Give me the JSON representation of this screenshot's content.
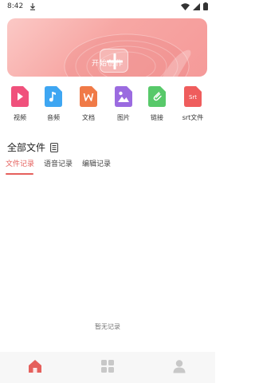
{
  "status_bar": {
    "time": "8:42"
  },
  "banner": {
    "label": "开始创作"
  },
  "tools": [
    {
      "label": "视频",
      "icon": "video-icon",
      "color": "#f0517c"
    },
    {
      "label": "音频",
      "icon": "audio-icon",
      "color": "#3ea6f2"
    },
    {
      "label": "文档",
      "icon": "word-doc-icon",
      "color": "#f07a47"
    },
    {
      "label": "图片",
      "icon": "image-icon",
      "color": "#9b6be0"
    },
    {
      "label": "链接",
      "icon": "link-icon",
      "color": "#58c96a"
    },
    {
      "label": "srt文件",
      "icon": "srt-file-icon",
      "color": "#ef5d5d",
      "badge": "Srt"
    }
  ],
  "section": {
    "title": "全部文件"
  },
  "tabs": [
    {
      "label": "文件记录",
      "active": true
    },
    {
      "label": "语音记录",
      "active": false
    },
    {
      "label": "编辑记录",
      "active": false
    }
  ],
  "empty_state": {
    "text": "暂无记录"
  },
  "bottom_nav": [
    {
      "icon": "home-icon",
      "active": true
    },
    {
      "icon": "grid-icon",
      "active": false
    },
    {
      "icon": "profile-icon",
      "active": false
    }
  ],
  "colors": {
    "accent": "#e5605c",
    "inactive": "#c8c8c8"
  }
}
